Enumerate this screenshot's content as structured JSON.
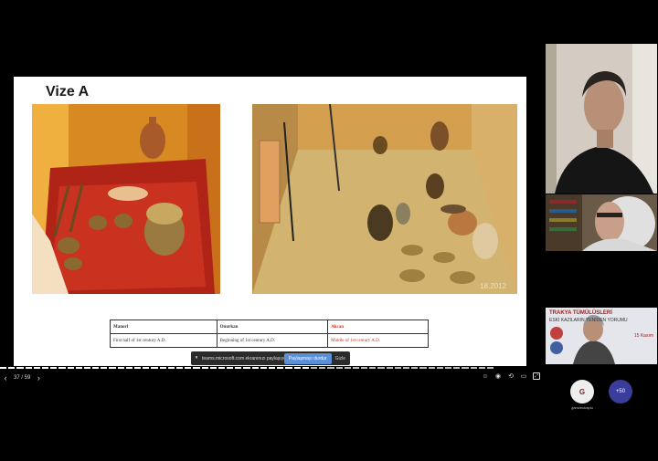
{
  "slide": {
    "title": "Vize A",
    "photo_date": "18.2012",
    "table": {
      "headers": [
        "Manorl",
        "Onurkan",
        "Akcan"
      ],
      "rows": [
        [
          "First half of 1st century A.D.",
          "Beginning of 1st century A.D.",
          "Middle of 1st century A.D."
        ]
      ]
    }
  },
  "share_bar": {
    "message": "teams.microsoft.com ekranınızı paylaşıyor.",
    "stop_label": "Paylaşmayı durdur",
    "hide_label": "Gizle"
  },
  "controls": {
    "page_indicator": "37 / 59",
    "progress_current": 37,
    "progress_total": 59
  },
  "participants": {
    "avatar_initial": "G",
    "avatar_name": "gamzeukaplu",
    "more_count": "+50"
  },
  "poster": {
    "title": "TRAKYA TÜMÜLÜSLERİ",
    "subtitle": "ESKİ KAZILARIN YENİDEN YORUMU",
    "date": "15 Kasım"
  },
  "colors": {
    "accent_red": "#d03020",
    "stop_button": "#5b8fd8",
    "more_avatar": "#3a3d99"
  }
}
